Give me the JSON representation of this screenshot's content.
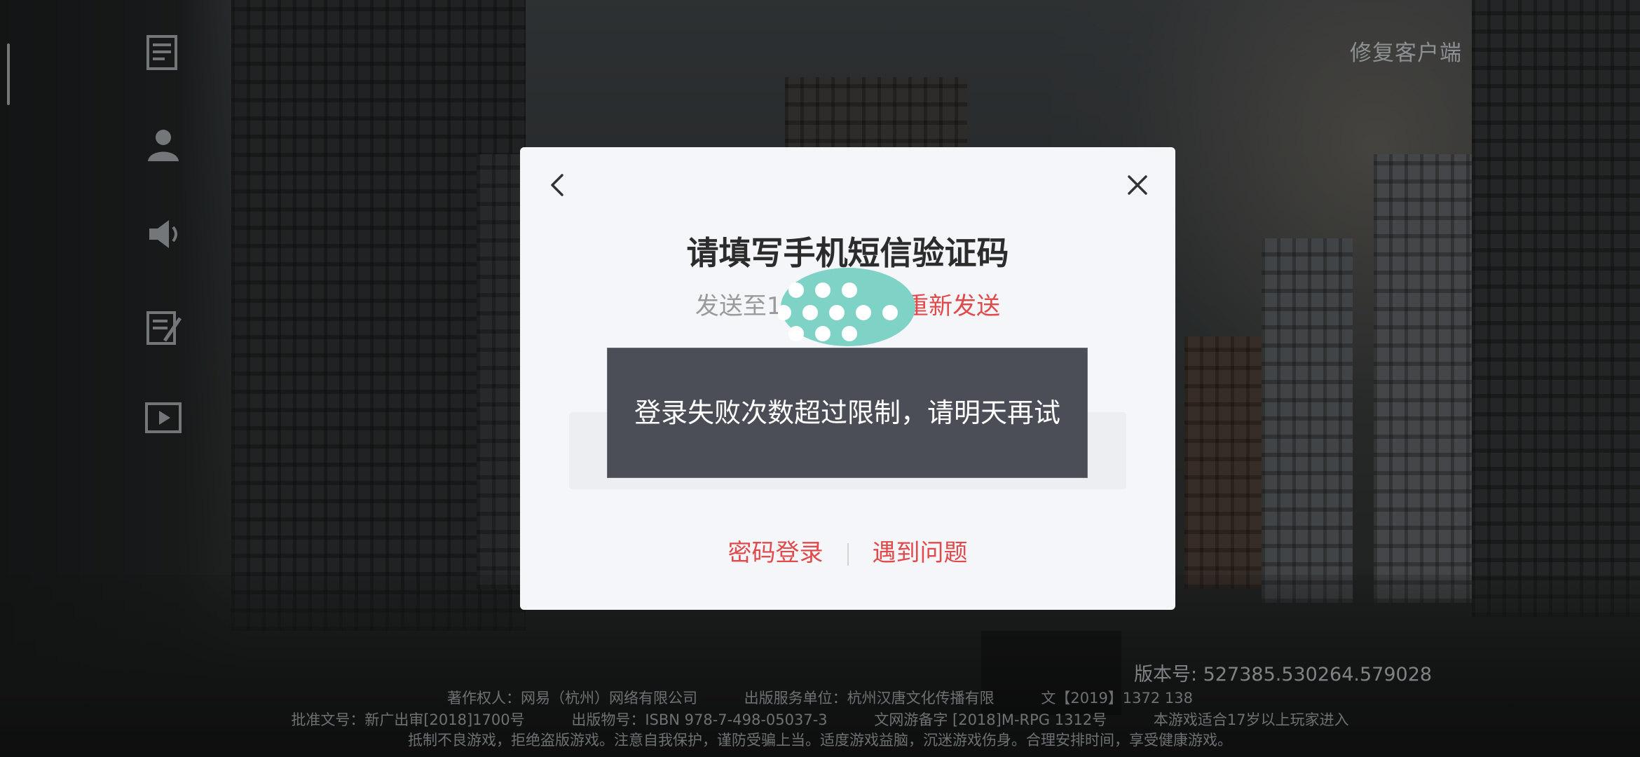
{
  "header": {
    "repair_label": "修复客户端"
  },
  "side_icons": [
    "announcement-icon",
    "user-icon",
    "speaker-icon",
    "notes-icon",
    "video-icon"
  ],
  "dialog": {
    "title": "请填写手机短信验证码",
    "sent_prefix": "发送至18",
    "resend_label": "重新发送",
    "toast_message": "登录失败次数超过限制，请明天再试",
    "password_login_label": "密码登录",
    "problem_label": "遇到问题"
  },
  "footer": {
    "version": "版本号: 527385.530264.579028",
    "line1_copyright": "著作权人：网易（杭州）网络有限公司",
    "line1_publisher": "出版服务单位：杭州汉唐文化传播有限",
    "line1_license": "文【2019】1372 138",
    "line2_approval": "批准文号：新广出审[2018]1700号",
    "line2_isbn": "出版物号：ISBN 978-7-498-05037-3",
    "line2_record": "文网游备字 [2018]M-RPG 1312号",
    "line2_age": "本游戏适合17岁以上玩家进入",
    "line3_notice": "抵制不良游戏，拒绝盗版游戏。注意自我保护，谨防受骗上当。适度游戏益脑，沉迷游戏伤身。合理安排时间，享受健康游戏。"
  },
  "colors": {
    "accent_red": "#e04a4a",
    "dialog_bg": "#f5f6f9",
    "toast_bg": "#4b4e56",
    "title_text": "#2c2c2c"
  }
}
